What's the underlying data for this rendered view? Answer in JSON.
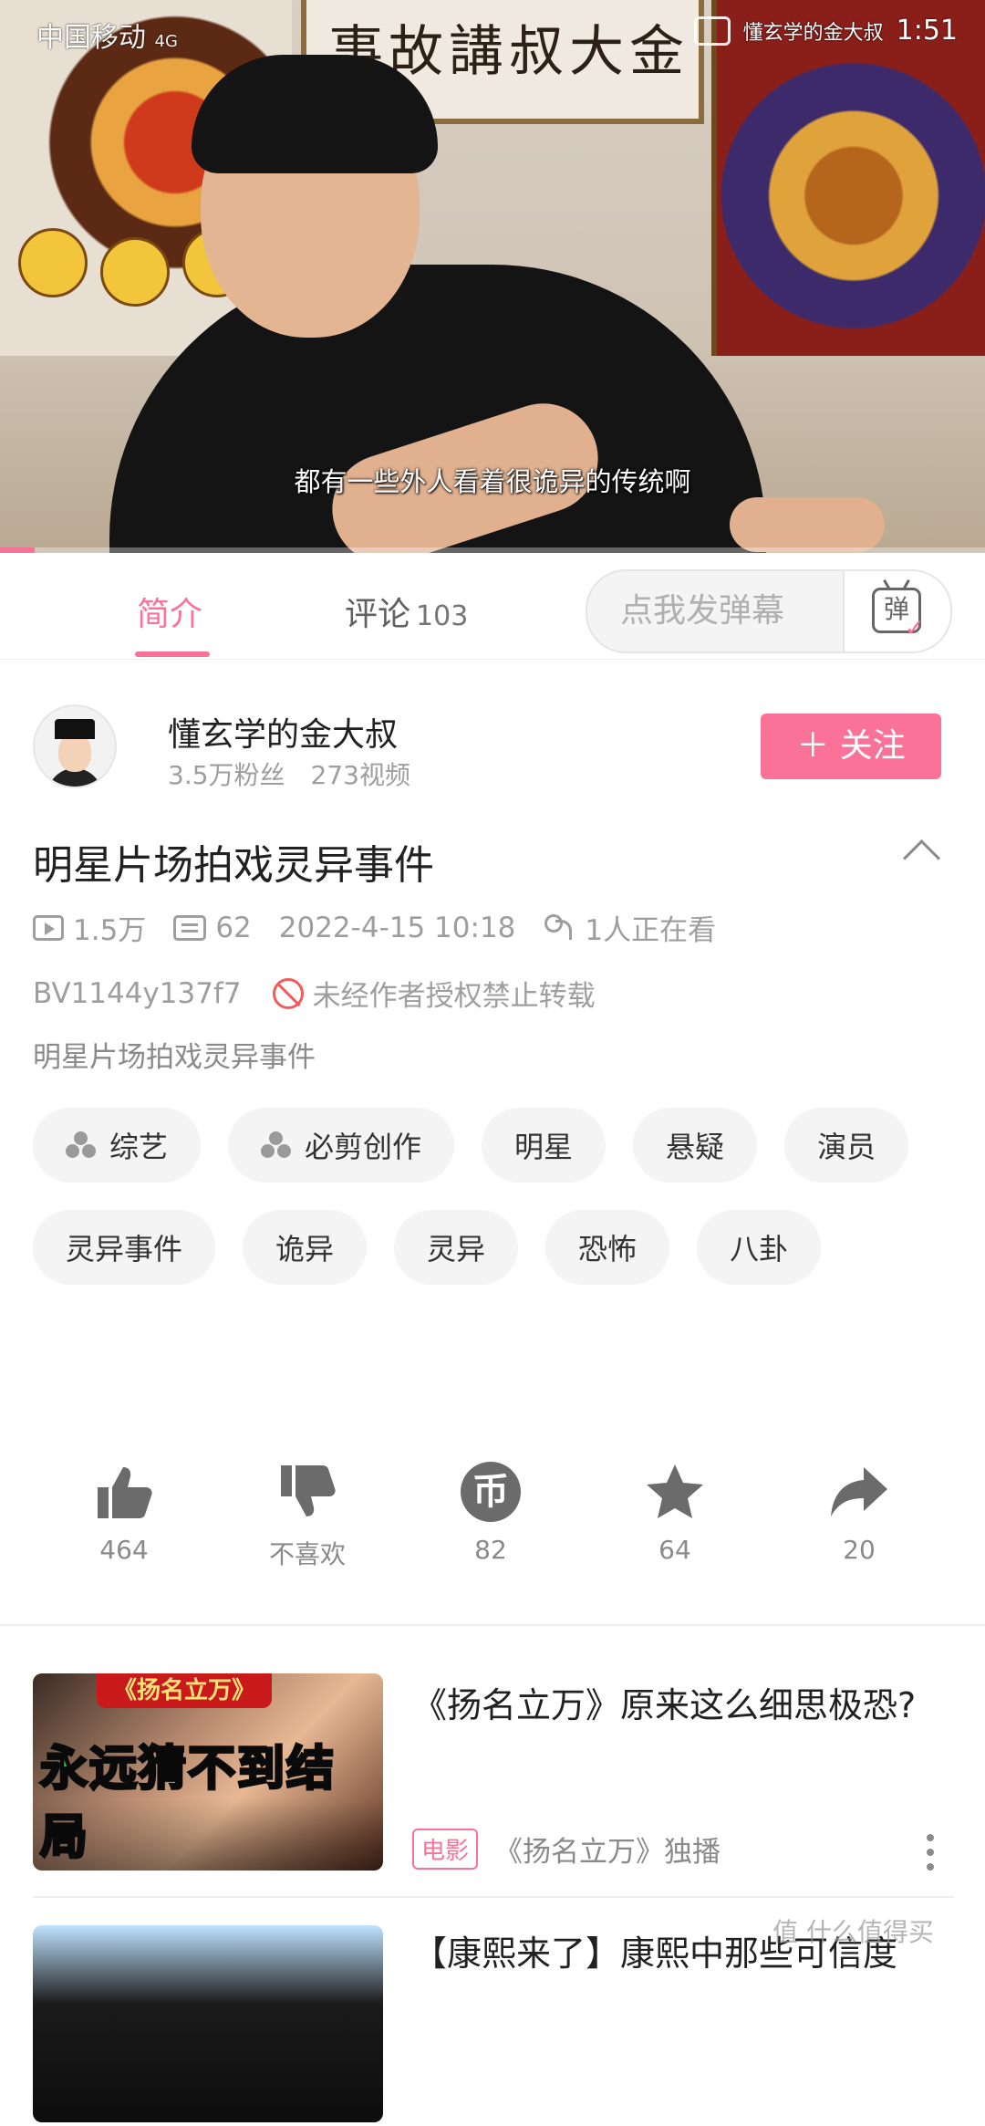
{
  "status_bar": {
    "carrier": "中国移动",
    "network": "4G",
    "uploader_chip": "懂玄学的金大叔",
    "time": "1:51"
  },
  "video": {
    "calligraphy": "事故講叔大金",
    "subtitle": "都有一些外人看着很诡异的传统啊",
    "progress_fraction": 0.035
  },
  "tabs": [
    {
      "label": "简介"
    },
    {
      "label": "评论",
      "count": "103"
    }
  ],
  "danmaku": {
    "placeholder": "点我发弹幕",
    "button_glyph": "弹"
  },
  "uploader": {
    "name": "懂玄学的金大叔",
    "fans": "3.5万粉丝",
    "videos": "273视频",
    "follow_label": "关注"
  },
  "video_info": {
    "title": "明星片场拍戏灵异事件",
    "plays": "1.5万",
    "danmaku_count": "62",
    "pub_time": "2022-4-15 10:18",
    "watching": "1人正在看",
    "bvid": "BV1144y137f7",
    "copyright_notice": "未经作者授权禁止转载",
    "description": "明星片场拍戏灵异事件"
  },
  "tags": [
    {
      "label": "综艺",
      "icon": "channel-icon"
    },
    {
      "label": "必剪创作",
      "icon": "channel-icon"
    },
    {
      "label": "明星"
    },
    {
      "label": "悬疑"
    },
    {
      "label": "演员"
    },
    {
      "label": "灵异事件"
    },
    {
      "label": "诡异"
    },
    {
      "label": "灵异"
    },
    {
      "label": "恐怖"
    },
    {
      "label": "八卦"
    }
  ],
  "actions": {
    "like": "464",
    "dislike": "不喜欢",
    "coin": "82",
    "coin_glyph": "币",
    "favorite": "64",
    "share": "20"
  },
  "recommendations": [
    {
      "title": "《扬名立万》原来这么细思极恐?",
      "badge": "电影",
      "meta": "《扬名立万》独播",
      "thumb_top": "《扬名立万》",
      "thumb_big_1": "永远",
      "thumb_big_2": "猜",
      "thumb_big_3": "不到",
      "thumb_big_4": "结局"
    },
    {
      "title": "【康熙来了】康熙中那些可信度"
    }
  ],
  "watermark": "值 什么值得买",
  "colors": {
    "accent": "#fb7299"
  }
}
